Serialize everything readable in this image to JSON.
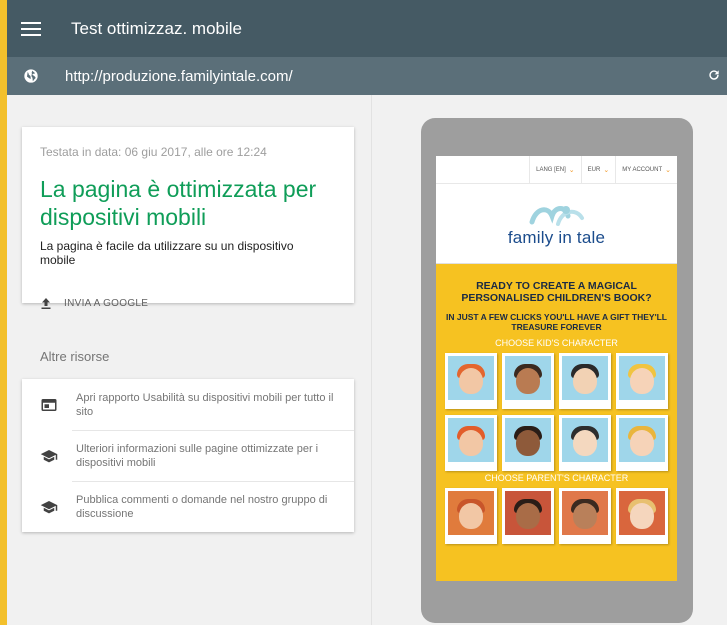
{
  "app": {
    "title": "Test ottimizzaz. mobile",
    "url": "http://produzione.familyintale.com/"
  },
  "result": {
    "date": "Testata in data: 06 giu 2017, alle ore 12:24",
    "headline": "La pagina è ottimizzata per dispositivi mobili",
    "subtitle": "La pagina è facile da utilizzare su un dispositivo mobile",
    "send_label": "INVIA A GOOGLE"
  },
  "resources": {
    "title": "Altre risorse",
    "items": [
      {
        "icon": "web-icon",
        "label": "Apri rapporto Usabilità su dispositivi mobili per tutto il sito"
      },
      {
        "icon": "school-icon",
        "label": "Ulteriori informazioni sulle pagine ottimizzate per i dispositivi mobili"
      },
      {
        "icon": "school-icon",
        "label": "Pubblica commenti o domande nel nostro gruppo di discussione"
      }
    ]
  },
  "preview": {
    "lang": "LANG [EN]",
    "currency": "EUR",
    "account": "MY ACCOUNT",
    "logo_text": "family in tale",
    "hero_title": "READY TO CREATE A MAGICAL PERSONALISED CHILDREN'S BOOK?",
    "hero_sub": "IN JUST A FEW CLICKS YOU'LL HAVE A GIFT THEY'LL TREASURE FOREVER",
    "kids_label": "CHOOSE KID'S CHARACTER",
    "parents_label": "CHOOSE PARENT'S CHARACTER"
  },
  "colors": {
    "topbar": "#455a64",
    "urlbar": "#5b6f79",
    "success": "#0f9d58",
    "site_yellow": "#f6c221"
  }
}
